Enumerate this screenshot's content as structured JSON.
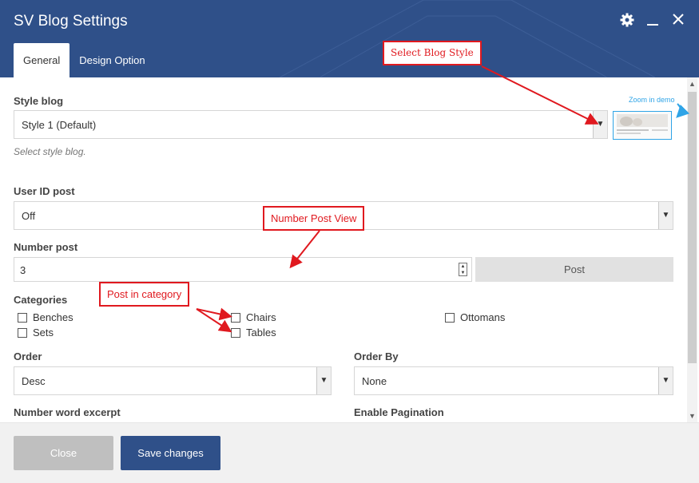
{
  "header": {
    "title": "SV Blog Settings",
    "tabs": [
      {
        "label": "General",
        "active": true
      },
      {
        "label": "Design Option",
        "active": false
      }
    ]
  },
  "style_blog": {
    "label": "Style blog",
    "value": "Style 1 (Default)",
    "description": "Select style blog.",
    "zoom_label": "Zoom in demo"
  },
  "user_id_post": {
    "label": "User ID post",
    "value": "Off"
  },
  "number_post": {
    "label": "Number post",
    "value": "3",
    "button_label": "Post"
  },
  "categories": {
    "label": "Categories",
    "items": [
      {
        "label": "Benches",
        "checked": false
      },
      {
        "label": "Sets",
        "checked": false
      },
      {
        "label": "Chairs",
        "checked": false
      },
      {
        "label": "Tables",
        "checked": false
      },
      {
        "label": "Ottomans",
        "checked": false
      }
    ]
  },
  "order": {
    "label": "Order",
    "value": "Desc"
  },
  "order_by": {
    "label": "Order By",
    "value": "None"
  },
  "number_word_excerpt": {
    "label": "Number word excerpt"
  },
  "enable_pagination": {
    "label": "Enable Pagination"
  },
  "footer": {
    "close_label": "Close",
    "save_label": "Save changes"
  },
  "annotations": {
    "select_blog_style": "Select Blog Style",
    "number_post_view": "Number Post View",
    "post_in_category": "Post in category"
  },
  "colors": {
    "header_bg": "#2f5089",
    "annotation": "#e0191f",
    "link": "#2fa4e7"
  }
}
